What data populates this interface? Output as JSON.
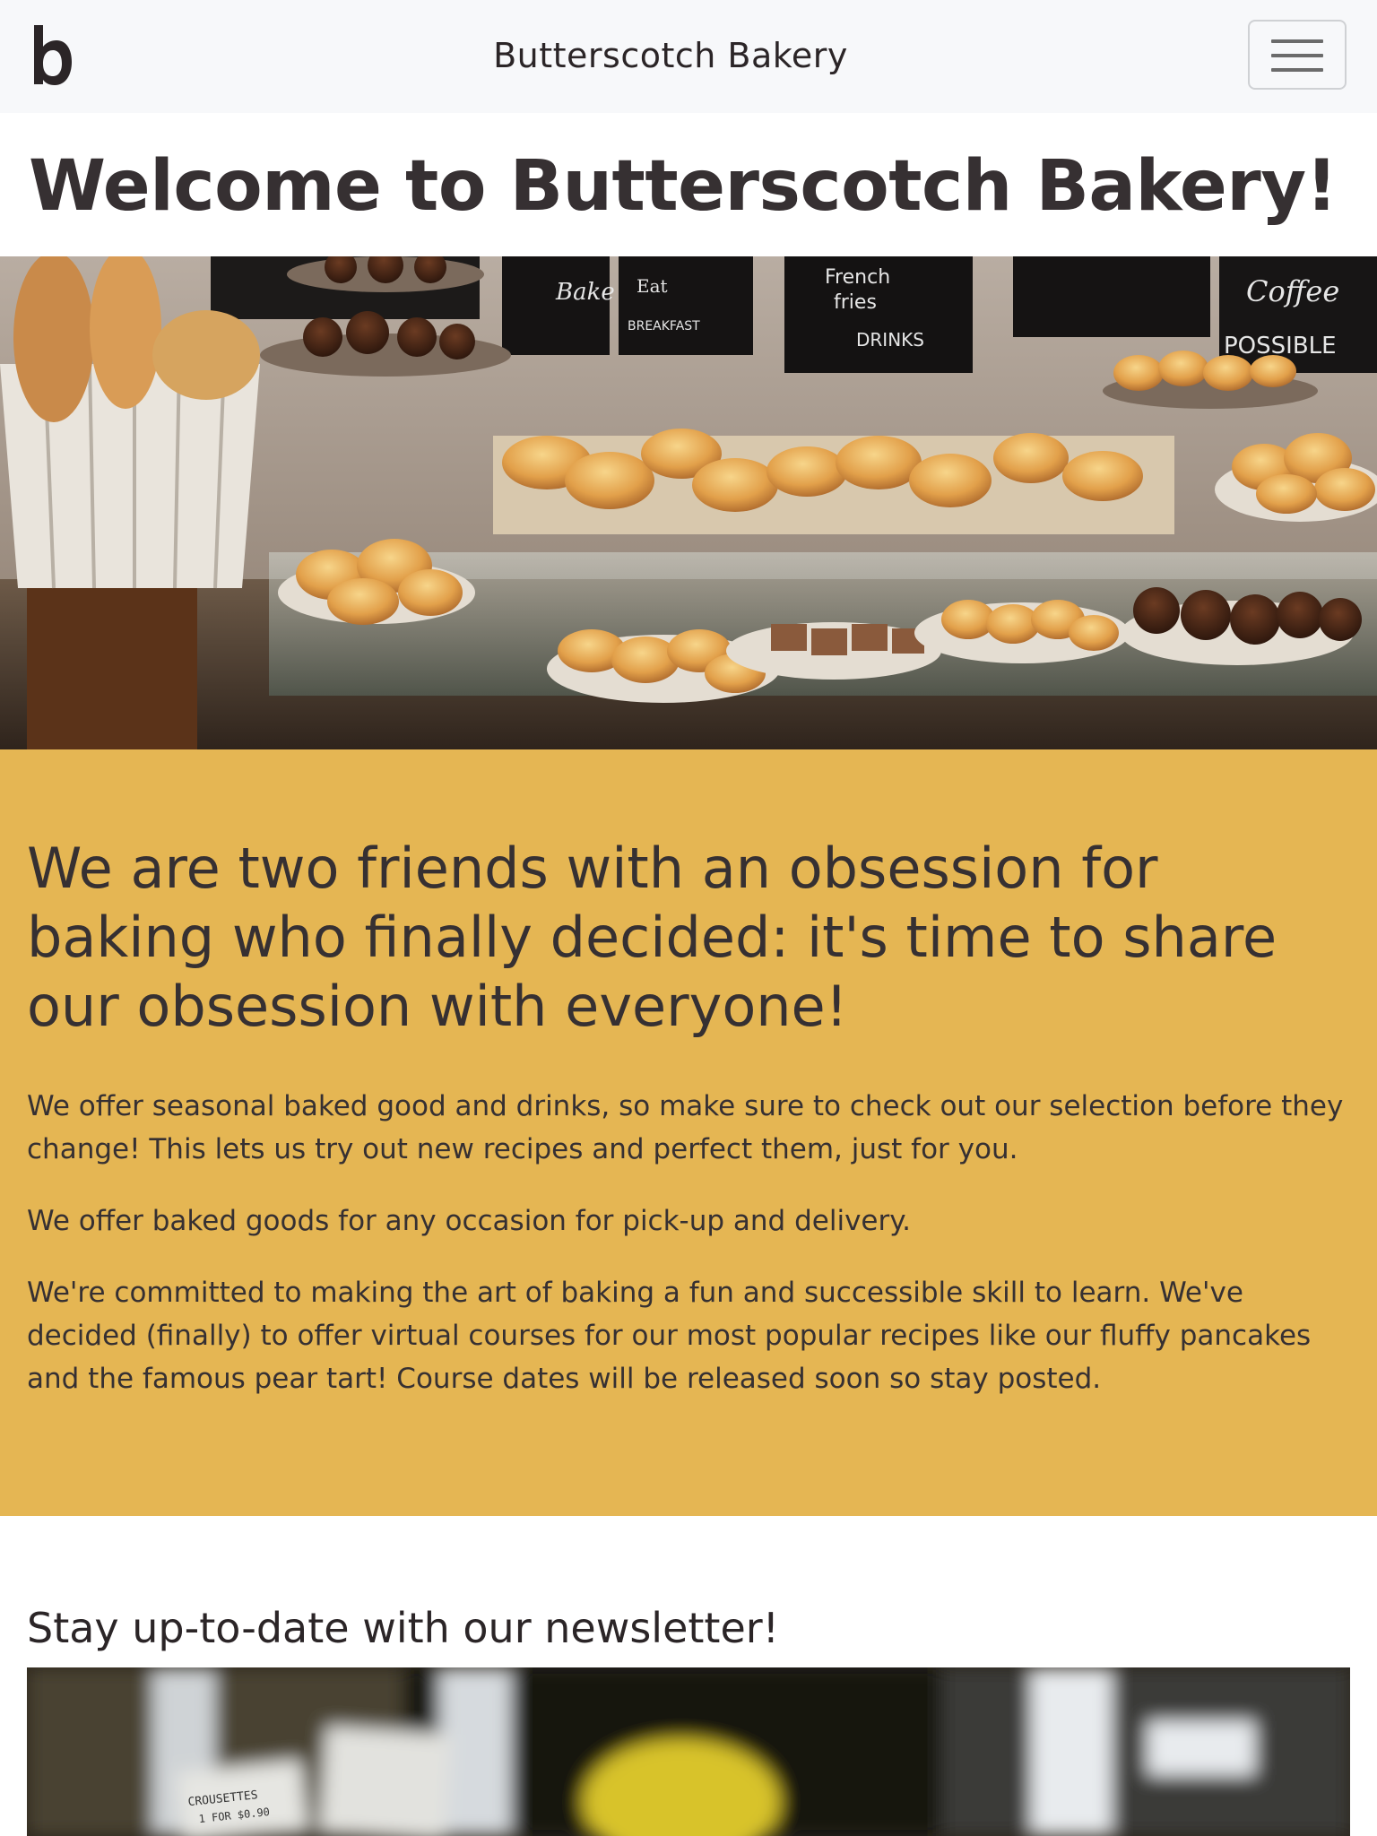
{
  "navbar": {
    "brand_letter": "b",
    "title": "Butterscotch Bakery",
    "menu_icon": "hamburger-menu-icon"
  },
  "hero": {
    "heading": "Welcome to Butterscotch Bakery!",
    "image": "bakery-pastry-display-photo",
    "chalkboard_signs": [
      "Bake IT",
      "Eat Coffee FOR BREAKFAST",
      "French fries & COLD hot DRINKS",
      "Coffee EVERYTHING POSSIBLE"
    ]
  },
  "about": {
    "heading": "We are two friends with an obsession for baking who finally decided: it's time to share our obsession with everyone!",
    "paragraphs": [
      "We offer seasonal baked good and drinks, so make sure to check out our selection before they change! This lets us try out new recipes and perfect them, just for you.",
      "We offer baked goods for any occasion for pick-up and delivery.",
      "We're committed to making the art of baking a fun and successible skill to learn. We've decided (finally) to offer virtual courses for our most popular recipes like our fluffy pancakes and the famous pear tart! Course dates will be released soon so stay posted."
    ]
  },
  "newsletter": {
    "heading": "Stay up-to-date with our newsletter!",
    "image": "blurred-bakery-storefront-photo"
  },
  "colors": {
    "navbar_bg": "#f7f8fa",
    "accent_mustard": "#e5b653",
    "text_dark": "#363032"
  }
}
